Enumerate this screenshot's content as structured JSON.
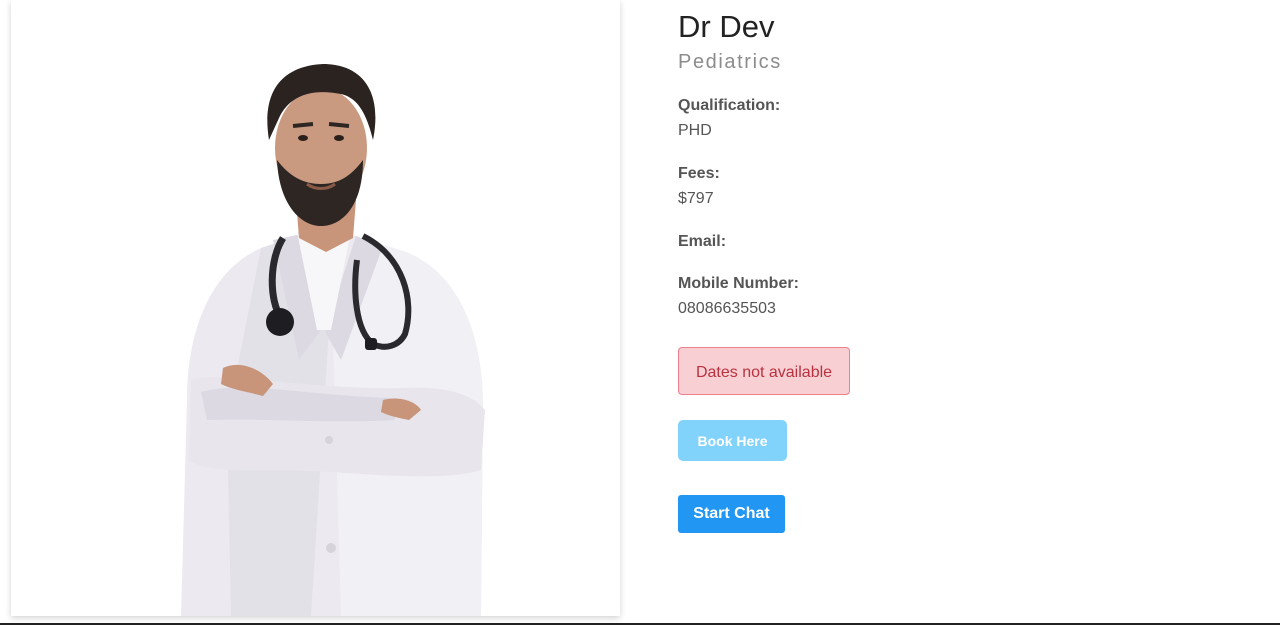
{
  "doctor": {
    "name": "Dr Dev",
    "specialty": "Pediatrics",
    "photo_icon": "doctor-portrait"
  },
  "fields": {
    "qualification_label": "Qualification:",
    "qualification_value": "PHD",
    "fees_label": "Fees:",
    "fees_value": "$797",
    "email_label": "Email:",
    "email_value": "",
    "mobile_label": "Mobile Number:",
    "mobile_value": "08086635503"
  },
  "alert": {
    "text": "Dates not available",
    "color": "#b8323f"
  },
  "actions": {
    "book_label": "Book Here",
    "chat_label": "Start Chat"
  },
  "colors": {
    "primary": "#2196f3",
    "book_disabled": "#82d3fb",
    "alert_bg": "#f8d0d4"
  }
}
